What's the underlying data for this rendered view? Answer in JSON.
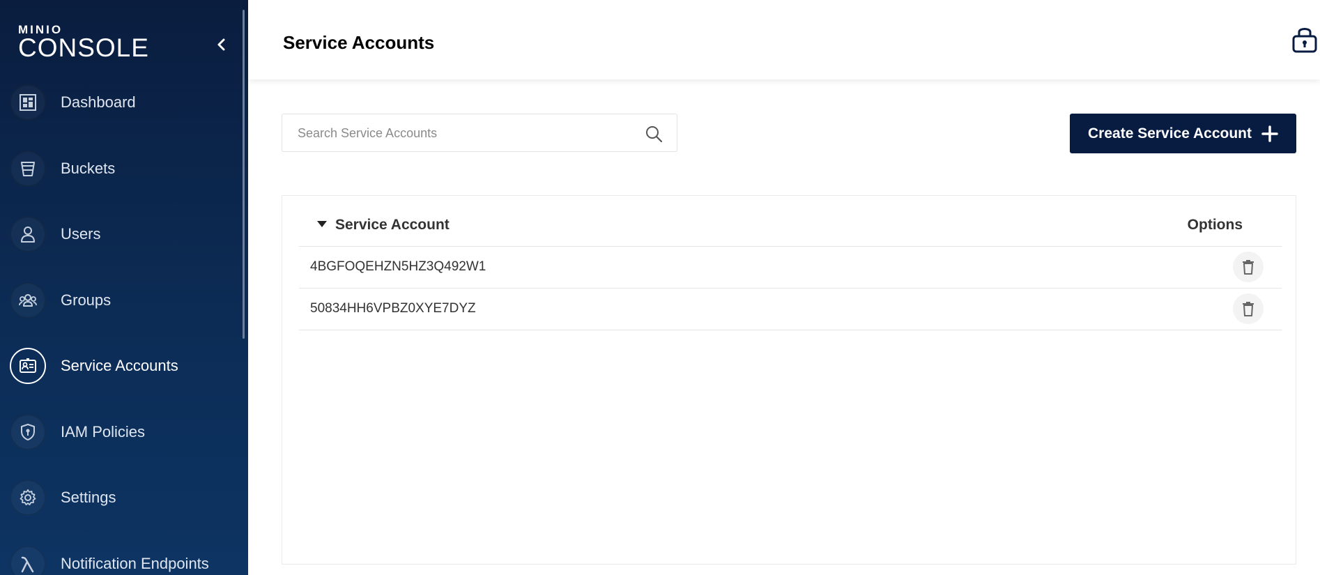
{
  "brand": {
    "top": "MINIO",
    "bottom": "CONSOLE"
  },
  "sidebar": {
    "items": [
      {
        "label": "Dashboard",
        "icon": "dashboard-icon",
        "active": false
      },
      {
        "label": "Buckets",
        "icon": "bucket-icon",
        "active": false
      },
      {
        "label": "Users",
        "icon": "user-icon",
        "active": false
      },
      {
        "label": "Groups",
        "icon": "groups-icon",
        "active": false
      },
      {
        "label": "Service Accounts",
        "icon": "id-card-icon",
        "active": true
      },
      {
        "label": "IAM Policies",
        "icon": "shield-icon",
        "active": false
      },
      {
        "label": "Settings",
        "icon": "gear-icon",
        "active": false
      },
      {
        "label": "Notification Endpoints",
        "icon": "lambda-icon",
        "active": false
      }
    ]
  },
  "header": {
    "title": "Service Accounts",
    "lock_icon": "lock-icon"
  },
  "search": {
    "placeholder": "Search Service Accounts",
    "value": ""
  },
  "toolbar": {
    "create_label": "Create Service Account"
  },
  "table": {
    "columns": {
      "account": "Service Account",
      "options": "Options"
    },
    "sort_direction": "descending",
    "rows": [
      {
        "account": "4BGFOQEHZN5HZ3Q492W1"
      },
      {
        "account": "50834HH6VPBZ0XYE7DYZ"
      }
    ]
  },
  "colors": {
    "primary": "#081c42",
    "sidebar_top": "#0a1d3f",
    "sidebar_bottom": "#0d3463"
  }
}
